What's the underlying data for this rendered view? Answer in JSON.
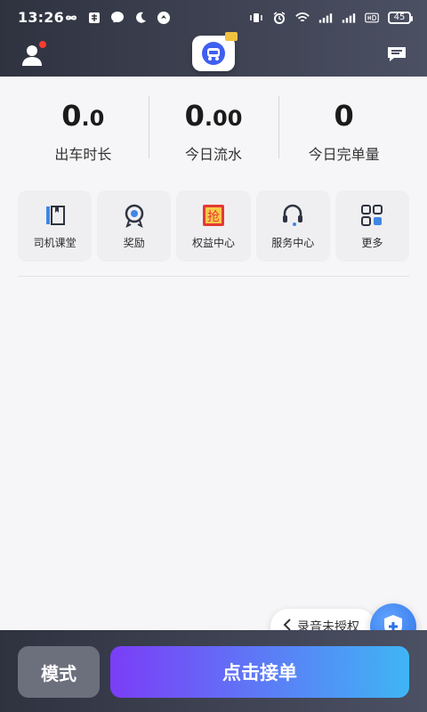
{
  "status_bar": {
    "time": "13:26",
    "battery": "45",
    "left_icons": [
      "infinity-icon",
      "chinese-char-icon",
      "chat-bubble-icon",
      "moon-icon",
      "bird-icon"
    ],
    "right_icons": [
      "vibrate-icon",
      "alarm-icon",
      "wifi-icon",
      "signal-1-icon",
      "signal-2-icon",
      "hd-icon",
      "battery-icon"
    ]
  },
  "top_nav": {
    "left_icon": "user-icon",
    "center_icon": "app-logo",
    "right_icon": "message-icon",
    "badge_color": "#ff3b30"
  },
  "stats": [
    {
      "value_main": "0",
      "value_dec": ".0",
      "label": "出车时长"
    },
    {
      "value_main": "0",
      "value_dec": ".00",
      "label": "今日流水"
    },
    {
      "value_main": "0",
      "value_dec": "",
      "label": "今日完单量"
    }
  ],
  "shortcuts": [
    {
      "label": "司机课堂",
      "icon": "book-icon"
    },
    {
      "label": "奖励",
      "icon": "medal-icon"
    },
    {
      "label": "权益中心",
      "icon": "grab-badge-icon"
    },
    {
      "label": "服务中心",
      "icon": "headset-icon"
    },
    {
      "label": "更多",
      "icon": "grid-icon"
    }
  ],
  "recording_prompt": {
    "text": "录音未授权",
    "icon": "shield-plus-icon"
  },
  "bottom_bar": {
    "mode_label": "模式",
    "accept_label": "点击接单"
  },
  "colors": {
    "header_dark": "#2f3340",
    "accent_purple": "#7b3df7",
    "accent_blue": "#3fb5f5",
    "shield_blue": "#2c72e6"
  }
}
